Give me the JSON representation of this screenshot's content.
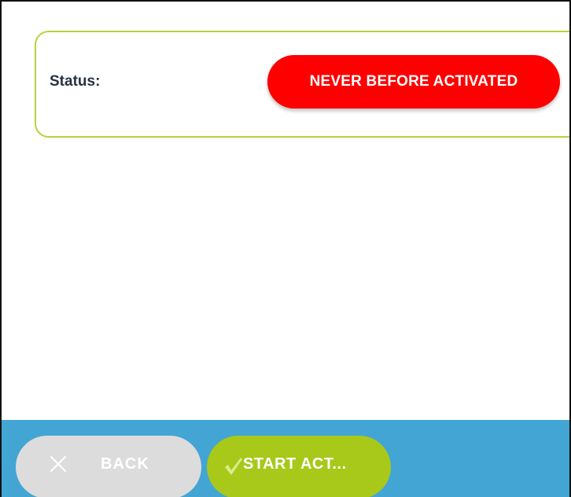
{
  "status_card": {
    "label": "Status:",
    "badge_text": "NEVER BEFORE ACTIVATED",
    "badge_color": "#ff0000",
    "border_color": "#b6d33c"
  },
  "footer": {
    "background_color": "#42a5d4",
    "back_button": {
      "label": "BACK",
      "icon": "close-icon",
      "color": "#dcdcdc"
    },
    "start_button": {
      "label": "START ACT...",
      "icon": "check-icon",
      "color": "#a8c81a"
    }
  }
}
